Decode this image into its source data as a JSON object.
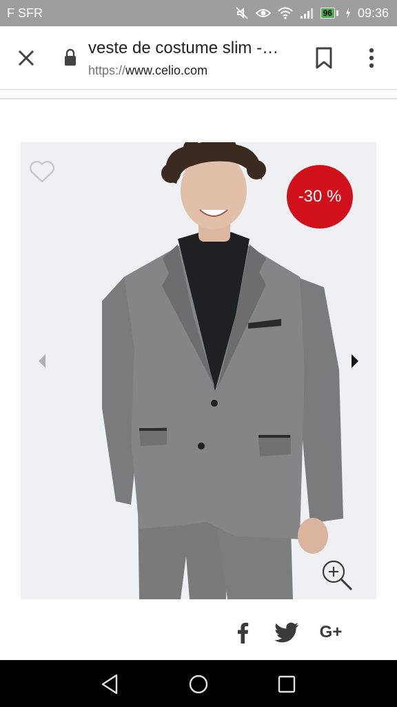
{
  "status_bar": {
    "carrier": "F SFR",
    "battery": "96",
    "time": "09:36",
    "icons": [
      "mute-icon",
      "eye-icon",
      "wifi-icon",
      "signal-icon",
      "battery-icon",
      "charging-icon"
    ]
  },
  "browser": {
    "page_title": "veste de costume slim -…",
    "url_scheme": "https://",
    "url_host": "www.celio.com",
    "icons": [
      "close-icon",
      "lock-icon",
      "bookmark-icon",
      "overflow-menu-icon"
    ]
  },
  "product": {
    "discount_badge": "-30 %",
    "badge_color": "#d0101b",
    "icons": [
      "heart-icon",
      "chevron-left-icon",
      "chevron-right-icon",
      "zoom-in-icon"
    ]
  },
  "share": {
    "icons": [
      "facebook-icon",
      "twitter-icon",
      "google-plus-icon"
    ],
    "google_plus_label": "G+"
  },
  "android_nav": {
    "icons": [
      "back-icon",
      "home-icon",
      "recents-icon"
    ]
  }
}
